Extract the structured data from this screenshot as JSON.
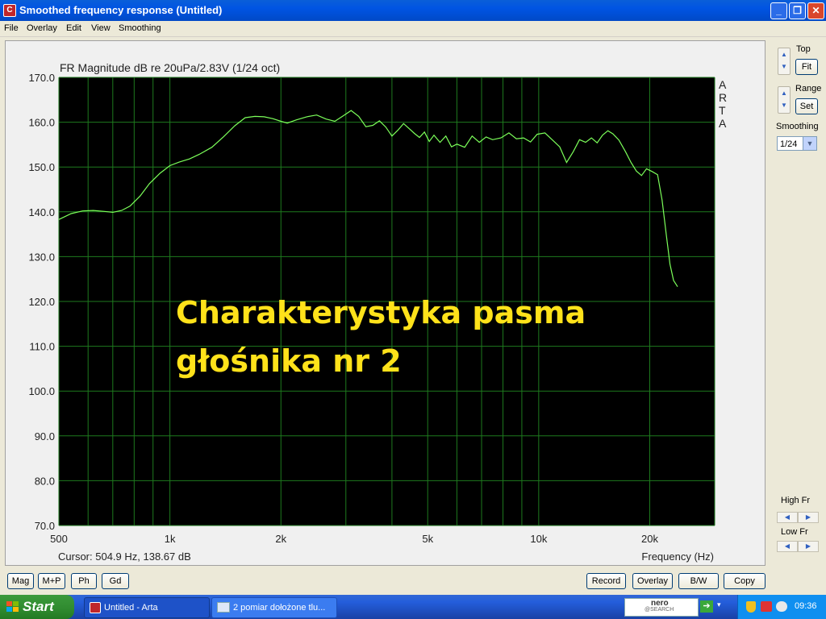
{
  "window": {
    "title": "Smoothed frequency response (Untitled)",
    "app_icon_glyph": "C"
  },
  "menu": [
    "File",
    "Overlay",
    "Edit",
    "View",
    "Smoothing"
  ],
  "plot": {
    "header": "FR Magnitude dB re 20uPa/2.83V (1/24 oct)",
    "side_label": [
      "A",
      "R",
      "T",
      "A"
    ],
    "cursor_text": "Cursor: 504.9 Hz, 138.67 dB",
    "xlabel": "Frequency (Hz)",
    "overlay_lines": [
      "Charakterystyka pasma",
      "głośnika nr 2"
    ],
    "overlay_color": "#ffe21a"
  },
  "chart_data": {
    "type": "line",
    "title": "FR Magnitude dB re 20uPa/2.83V (1/24 oct)",
    "xlabel": "Frequency (Hz)",
    "ylabel": "",
    "xscale": "log",
    "xlim": [
      500,
      30000
    ],
    "ylim": [
      70,
      170
    ],
    "grid": true,
    "background": "#000000",
    "line_color": "#7cff5a",
    "grid_color": "#1e7a1e",
    "yticks": [
      "170.0",
      "160.0",
      "150.0",
      "140.0",
      "130.0",
      "120.0",
      "110.0",
      "100.0",
      "90.0",
      "80.0",
      "70.0"
    ],
    "xticks": [
      {
        "value": 500,
        "label": "500"
      },
      {
        "value": 1000,
        "label": "1k"
      },
      {
        "value": 2000,
        "label": "2k"
      },
      {
        "value": 5000,
        "label": "5k"
      },
      {
        "value": 10000,
        "label": "10k"
      },
      {
        "value": 20000,
        "label": "20k"
      }
    ],
    "series": [
      {
        "values": [
          [
            500,
            138.3
          ],
          [
            540,
            139.6
          ],
          [
            580,
            140.2
          ],
          [
            620,
            140.3
          ],
          [
            660,
            140.1
          ],
          [
            700,
            139.9
          ],
          [
            740,
            140.3
          ],
          [
            780,
            141.3
          ],
          [
            830,
            143.5
          ],
          [
            880,
            146.3
          ],
          [
            940,
            148.6
          ],
          [
            1000,
            150.3
          ],
          [
            1060,
            151.1
          ],
          [
            1130,
            151.8
          ],
          [
            1200,
            152.8
          ],
          [
            1300,
            154.4
          ],
          [
            1400,
            156.8
          ],
          [
            1500,
            159.2
          ],
          [
            1600,
            161.0
          ],
          [
            1700,
            161.3
          ],
          [
            1800,
            161.2
          ],
          [
            1900,
            160.8
          ],
          [
            2000,
            160.2
          ],
          [
            2080,
            159.8
          ],
          [
            2200,
            160.5
          ],
          [
            2350,
            161.2
          ],
          [
            2500,
            161.6
          ],
          [
            2650,
            160.7
          ],
          [
            2800,
            160.2
          ],
          [
            2950,
            161.4
          ],
          [
            3100,
            162.6
          ],
          [
            3250,
            161.3
          ],
          [
            3400,
            159.0
          ],
          [
            3550,
            159.3
          ],
          [
            3700,
            160.3
          ],
          [
            3850,
            158.9
          ],
          [
            4000,
            156.9
          ],
          [
            4150,
            158.2
          ],
          [
            4300,
            159.7
          ],
          [
            4450,
            158.6
          ],
          [
            4600,
            157.5
          ],
          [
            4750,
            156.6
          ],
          [
            4900,
            157.8
          ],
          [
            5050,
            155.7
          ],
          [
            5200,
            157.1
          ],
          [
            5400,
            155.5
          ],
          [
            5600,
            156.9
          ],
          [
            5800,
            154.5
          ],
          [
            6000,
            155.1
          ],
          [
            6300,
            154.4
          ],
          [
            6600,
            156.9
          ],
          [
            6900,
            155.5
          ],
          [
            7200,
            156.7
          ],
          [
            7500,
            156.1
          ],
          [
            7900,
            156.5
          ],
          [
            8300,
            157.6
          ],
          [
            8700,
            156.3
          ],
          [
            9100,
            156.5
          ],
          [
            9500,
            155.6
          ],
          [
            9900,
            157.3
          ],
          [
            10400,
            157.6
          ],
          [
            10900,
            156.0
          ],
          [
            11400,
            154.5
          ],
          [
            11900,
            151.0
          ],
          [
            12400,
            153.4
          ],
          [
            12900,
            156.1
          ],
          [
            13400,
            155.5
          ],
          [
            13900,
            156.5
          ],
          [
            14400,
            155.4
          ],
          [
            14900,
            157.1
          ],
          [
            15400,
            158.1
          ],
          [
            15900,
            157.4
          ],
          [
            16500,
            156.0
          ],
          [
            17200,
            153.4
          ],
          [
            17800,
            151.0
          ],
          [
            18400,
            149.1
          ],
          [
            19000,
            148.1
          ],
          [
            19600,
            149.6
          ],
          [
            20300,
            149.0
          ],
          [
            21000,
            148.3
          ],
          [
            21600,
            142.6
          ],
          [
            22200,
            134.6
          ],
          [
            22700,
            128.3
          ],
          [
            23200,
            124.7
          ],
          [
            23800,
            123.3
          ]
        ]
      }
    ]
  },
  "right_panel": {
    "top_label": "Top",
    "fit_button": "Fit",
    "range_label": "Range",
    "set_button": "Set",
    "smoothing_label": "Smoothing",
    "smoothing_value": "1/24",
    "high_fr_label": "High Fr",
    "low_fr_label": "Low Fr"
  },
  "bottom_buttons": {
    "mag": "Mag",
    "mp": "M+P",
    "ph": "Ph",
    "gd": "Gd",
    "record": "Record",
    "overlay": "Overlay",
    "bw": "B/W",
    "copy": "Copy"
  },
  "taskbar": {
    "start": "Start",
    "tasks": [
      "Untitled - Arta",
      "2 pomiar dołożone tlu..."
    ],
    "nero_label": "nero",
    "nero_sub": "@SEARCH",
    "clock": "09:36"
  }
}
